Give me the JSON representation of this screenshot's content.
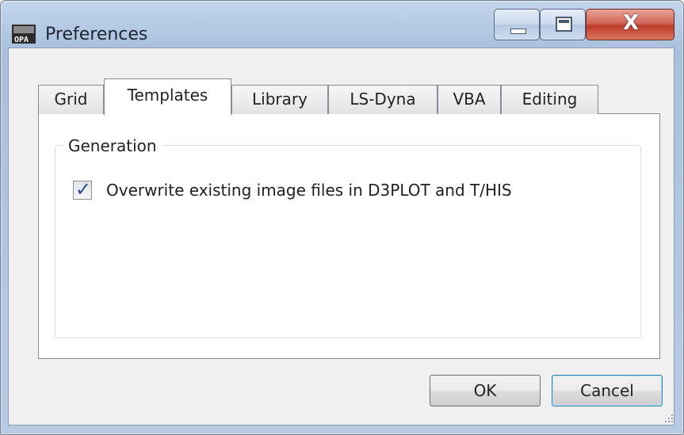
{
  "window": {
    "title": "Preferences",
    "app_icon": "opa-app-icon",
    "close_glyph": "X"
  },
  "tabs": [
    {
      "label": "Grid",
      "active": false
    },
    {
      "label": "Templates",
      "active": true
    },
    {
      "label": "Library",
      "active": false
    },
    {
      "label": "LS-Dyna",
      "active": false
    },
    {
      "label": "VBA",
      "active": false
    },
    {
      "label": "Editing",
      "active": false
    }
  ],
  "generation": {
    "group_title": "Generation",
    "overwrite_label": "Overwrite existing image files in D3PLOT and T/HIS",
    "overwrite_checked": true
  },
  "buttons": {
    "ok": "OK",
    "cancel": "Cancel"
  },
  "colors": {
    "title_gradient": "#b7cbe3",
    "close_red": "#c03a2a",
    "check_blue": "#2a4a8a",
    "default_button_border": "#3c7fb1"
  }
}
